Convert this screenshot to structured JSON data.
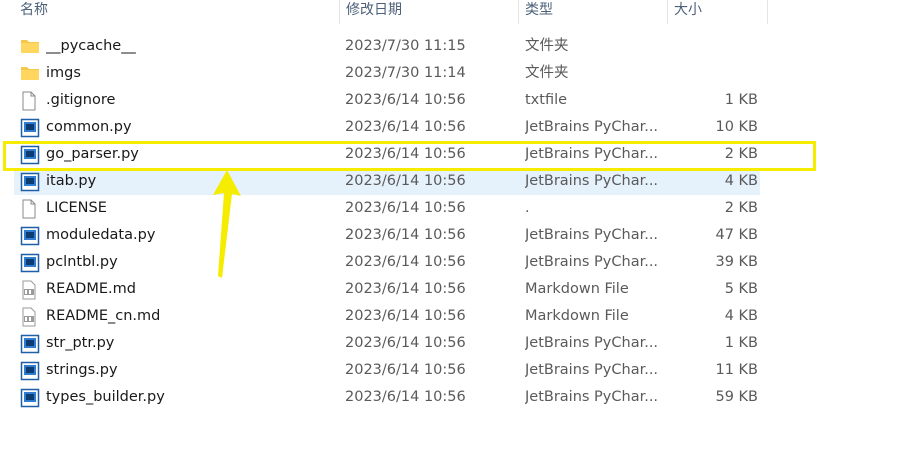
{
  "header": {
    "name": "名称",
    "date_modified": "修改日期",
    "type": "类型",
    "size": "大小"
  },
  "files": [
    {
      "name": "__pycache__",
      "date": "2023/7/30 11:15",
      "type": "文件夹",
      "size": "",
      "icon": "folder-icon"
    },
    {
      "name": "imgs",
      "date": "2023/7/30 11:14",
      "type": "文件夹",
      "size": "",
      "icon": "folder-icon"
    },
    {
      "name": ".gitignore",
      "date": "2023/6/14 10:56",
      "type": "txtfile",
      "size": "1 KB",
      "icon": "file-icon"
    },
    {
      "name": "common.py",
      "date": "2023/6/14 10:56",
      "type": "JetBrains PyChar...",
      "size": "10 KB",
      "icon": "pycharm-file-icon"
    },
    {
      "name": "go_parser.py",
      "date": "2023/6/14 10:56",
      "type": "JetBrains PyChar...",
      "size": "2 KB",
      "icon": "pycharm-file-icon"
    },
    {
      "name": "itab.py",
      "date": "2023/6/14 10:56",
      "type": "JetBrains PyChar...",
      "size": "4 KB",
      "icon": "pycharm-file-icon"
    },
    {
      "name": "LICENSE",
      "date": "2023/6/14 10:56",
      "type": ".",
      "size": "2 KB",
      "icon": "file-icon"
    },
    {
      "name": "moduledata.py",
      "date": "2023/6/14 10:56",
      "type": "JetBrains PyChar...",
      "size": "47 KB",
      "icon": "pycharm-file-icon"
    },
    {
      "name": "pclntbl.py",
      "date": "2023/6/14 10:56",
      "type": "JetBrains PyChar...",
      "size": "39 KB",
      "icon": "pycharm-file-icon"
    },
    {
      "name": "README.md",
      "date": "2023/6/14 10:56",
      "type": "Markdown File",
      "size": "5 KB",
      "icon": "markdown-file-icon"
    },
    {
      "name": "README_cn.md",
      "date": "2023/6/14 10:56",
      "type": "Markdown File",
      "size": "4 KB",
      "icon": "markdown-file-icon"
    },
    {
      "name": "str_ptr.py",
      "date": "2023/6/14 10:56",
      "type": "JetBrains PyChar...",
      "size": "1 KB",
      "icon": "pycharm-file-icon"
    },
    {
      "name": "strings.py",
      "date": "2023/6/14 10:56",
      "type": "JetBrains PyChar...",
      "size": "11 KB",
      "icon": "pycharm-file-icon"
    },
    {
      "name": "types_builder.py",
      "date": "2023/6/14 10:56",
      "type": "JetBrains PyChar...",
      "size": "59 KB",
      "icon": "pycharm-file-icon"
    }
  ],
  "colors": {
    "highlight_box": "#f5ec00",
    "arrow": "#f5ec00",
    "hover_row": "#e5f1fb"
  }
}
